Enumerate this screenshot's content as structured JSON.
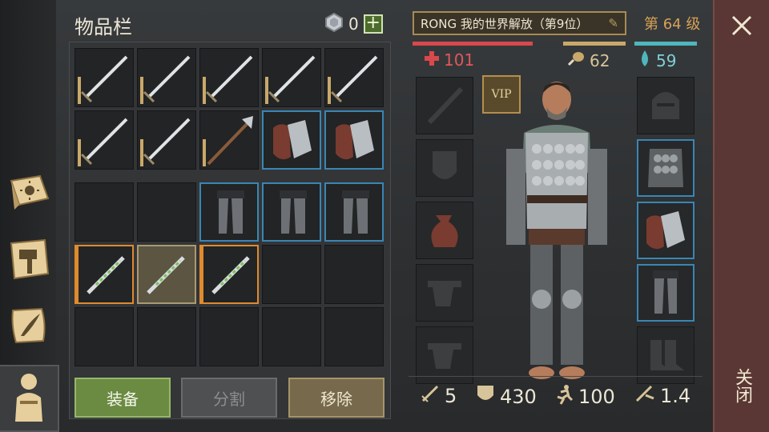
{
  "inventory": {
    "title": "物品栏",
    "gem_count": "0",
    "plus_label": "+",
    "rows_top": [
      [
        "sword",
        "sword",
        "sword",
        "sword",
        "sword"
      ],
      [
        "sword",
        "sword",
        "halberd",
        "gauntlets",
        "gauntlets"
      ]
    ],
    "rows_bottom": [
      [
        "empty",
        "empty",
        "legs",
        "legs",
        "legs"
      ],
      [
        "herb",
        "herb",
        "herb",
        "empty",
        "empty"
      ],
      [
        "empty",
        "empty",
        "empty",
        "empty",
        "empty"
      ]
    ],
    "buttons": {
      "equip": "装备",
      "split": "分割",
      "remove": "移除"
    }
  },
  "character": {
    "name": "RONG 我的世界解放（第9位）",
    "level": "第 64 级",
    "health": "101",
    "food": "62",
    "water": "59",
    "vip_label": "VIP",
    "stats": {
      "attack": "5",
      "armor": "430",
      "speed": "100",
      "weight": "1.4"
    }
  },
  "close_label": "关闭",
  "colors": {
    "health": "#d9484a",
    "food": "#c9a86a",
    "water": "#4fb6bd",
    "blue_frame": "#3a86b5",
    "orange_frame": "#e08a2e"
  }
}
